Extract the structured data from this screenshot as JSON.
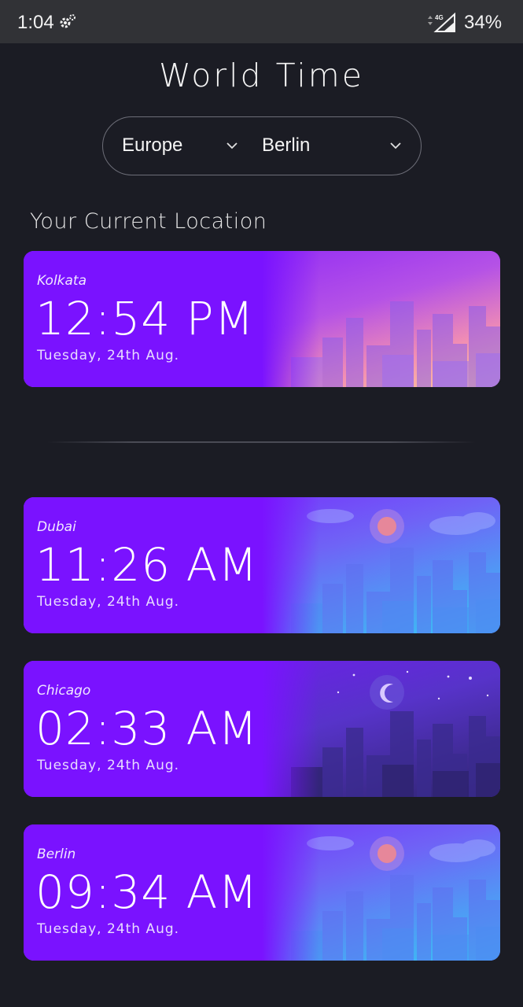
{
  "status_bar": {
    "time": "1:04",
    "network": "4G",
    "battery": "34%"
  },
  "title": "World Time",
  "selector": {
    "region": "Europe",
    "city": "Berlin"
  },
  "current_location_label": "Your Current Location",
  "current": {
    "city": "Kolkata",
    "time": "12:54 PM",
    "date": "Tuesday, 24th Aug.",
    "scene": "sunset"
  },
  "clocks": [
    {
      "city": "Dubai",
      "time": "11:26 AM",
      "date": "Tuesday, 24th Aug.",
      "scene": "day"
    },
    {
      "city": "Chicago",
      "time": "02:33 AM",
      "date": "Tuesday, 24th Aug.",
      "scene": "night"
    },
    {
      "city": "Berlin",
      "time": "09:34 AM",
      "date": "Tuesday, 24th Aug.",
      "scene": "day"
    }
  ],
  "colors": {
    "background": "#1b1c24",
    "card_purple": "#7a12ff",
    "day_blue": "#3ab0f5",
    "sunset_peach": "#ffc08f",
    "night_indigo": "#3a2a8a"
  }
}
